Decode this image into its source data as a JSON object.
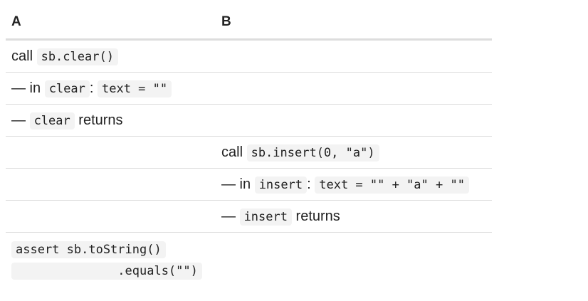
{
  "table": {
    "headers": [
      "A",
      "B"
    ],
    "rows": [
      {
        "a": {
          "text": "call ",
          "code": "sb.clear()"
        }
      },
      {
        "a": {
          "prefix": "— in ",
          "code1": "clear",
          "sep": ": ",
          "code2": "text = \"\""
        }
      },
      {
        "a": {
          "prefix": "— ",
          "code": "clear",
          "suffix": " returns"
        }
      },
      {
        "b": {
          "text": "call ",
          "code": "sb.insert(0, \"a\")"
        }
      },
      {
        "b": {
          "prefix": "— in ",
          "code1": "insert",
          "sep": ": ",
          "code2": "text = \"\" + \"a\" + \"\""
        }
      },
      {
        "b": {
          "prefix": "— ",
          "code": "insert",
          "suffix": " returns"
        }
      },
      {
        "a": {
          "line1": "assert sb.toString()",
          "line2": "              .equals(\"\")"
        }
      }
    ]
  }
}
